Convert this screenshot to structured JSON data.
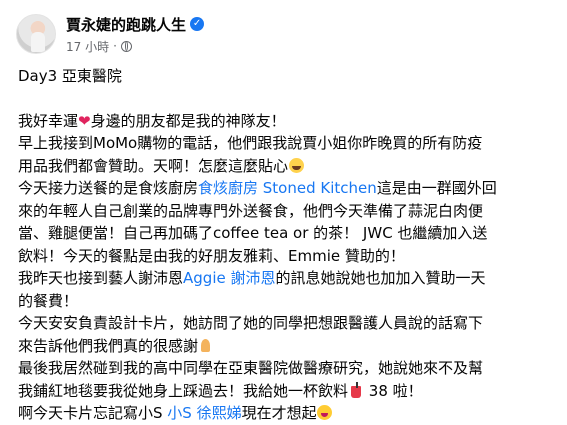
{
  "post": {
    "author": "賈永婕的跑跳人生",
    "verified_badge": "✓",
    "timestamp": "17 小時",
    "separator": "·",
    "audience_icon": "globe-icon",
    "title": "Day3 亞東醫院",
    "lines": {
      "l1a": "我好幸運",
      "l1_heart": "❤",
      "l1b": "身邊的朋友都是我的神隊友！",
      "l2": "早上我接到MoMo購物的電話，他們跟我說賈小姐你昨晚買的所有防疫",
      "l3": "用品我們都會贊助。天啊！怎麼這麼貼心",
      "l4a": "今天接力送餐的是食烗廚房",
      "l4_link": "食烗廚房 Stoned Kitchen",
      "l4b": "這是由一群國外回",
      "l5": "來的年輕人自己創業的品牌專門外送餐食，他們今天準備了蒜泥白肉便",
      "l6": "當、雞腿便當！自己再加碼了coffee tea or 的茶！ JWC 也繼續加入送",
      "l7": "飲料！今天的餐點是由我的好朋友雅莉、Emmie 贊助的！",
      "l8a": "我昨天也接到藝人謝沛恩",
      "l8_link": "Aggie 謝沛恩",
      "l8b": "的訊息她說她也加加入贊助一天",
      "l9": "的餐費！",
      "l10": "今天安安負責設計卡片，她訪問了她的同學把想跟醫護人員說的話寫下",
      "l11": "來告訴他們我們真的很感謝",
      "l12": "最後我居然碰到我的高中同學在亞東醫院做醫療研究，她說她來不及幫",
      "l13a": "我鋪紅地毯要我從她身上踩過去！我給她一杯飲料",
      "l13b": " 38 啦！",
      "l14a": "啊今天卡片忘記寫小S ",
      "l14_link": "小S 徐熙娣",
      "l14b": "現在才想起"
    }
  },
  "colors": {
    "link": "#1877f2",
    "text": "#050505",
    "meta": "#65676b"
  }
}
